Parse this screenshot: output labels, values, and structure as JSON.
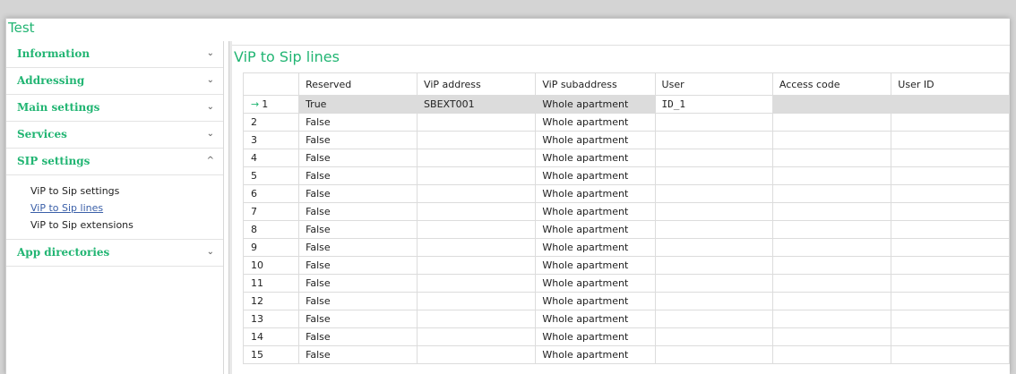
{
  "window": {
    "title": "Test"
  },
  "sidebar": {
    "sections": [
      {
        "label": "Information",
        "chevron": "⌄"
      },
      {
        "label": "Addressing",
        "chevron": "⌄"
      },
      {
        "label": "Main settings",
        "chevron": "⌄"
      },
      {
        "label": "Services",
        "chevron": "⌄"
      },
      {
        "label": "SIP settings",
        "chevron": "^"
      },
      {
        "label": "App directories",
        "chevron": "⌄"
      }
    ],
    "sip_items": [
      "ViP to Sip settings",
      "ViP to Sip lines",
      "ViP to Sip extensions"
    ]
  },
  "panel": {
    "title": "ViP to Sip lines",
    "columns": [
      "Reserved",
      "ViP address",
      "ViP subaddress",
      "User",
      "Access code",
      "User ID"
    ],
    "selected_marker": "→",
    "rows": [
      [
        "1",
        "True",
        "SBEXT001",
        "Whole apartment",
        "ID_1",
        "",
        ""
      ],
      [
        "2",
        "False",
        "",
        "Whole apartment",
        "",
        "",
        ""
      ],
      [
        "3",
        "False",
        "",
        "Whole apartment",
        "",
        "",
        ""
      ],
      [
        "4",
        "False",
        "",
        "Whole apartment",
        "",
        "",
        ""
      ],
      [
        "5",
        "False",
        "",
        "Whole apartment",
        "",
        "",
        ""
      ],
      [
        "6",
        "False",
        "",
        "Whole apartment",
        "",
        "",
        ""
      ],
      [
        "7",
        "False",
        "",
        "Whole apartment",
        "",
        "",
        ""
      ],
      [
        "8",
        "False",
        "",
        "Whole apartment",
        "",
        "",
        ""
      ],
      [
        "9",
        "False",
        "",
        "Whole apartment",
        "",
        "",
        ""
      ],
      [
        "10",
        "False",
        "",
        "Whole apartment",
        "",
        "",
        ""
      ],
      [
        "11",
        "False",
        "",
        "Whole apartment",
        "",
        "",
        ""
      ],
      [
        "12",
        "False",
        "",
        "Whole apartment",
        "",
        "",
        ""
      ],
      [
        "13",
        "False",
        "",
        "Whole apartment",
        "",
        "",
        ""
      ],
      [
        "14",
        "False",
        "",
        "Whole apartment",
        "",
        "",
        ""
      ],
      [
        "15",
        "False",
        "",
        "Whole apartment",
        "",
        "",
        ""
      ]
    ]
  }
}
